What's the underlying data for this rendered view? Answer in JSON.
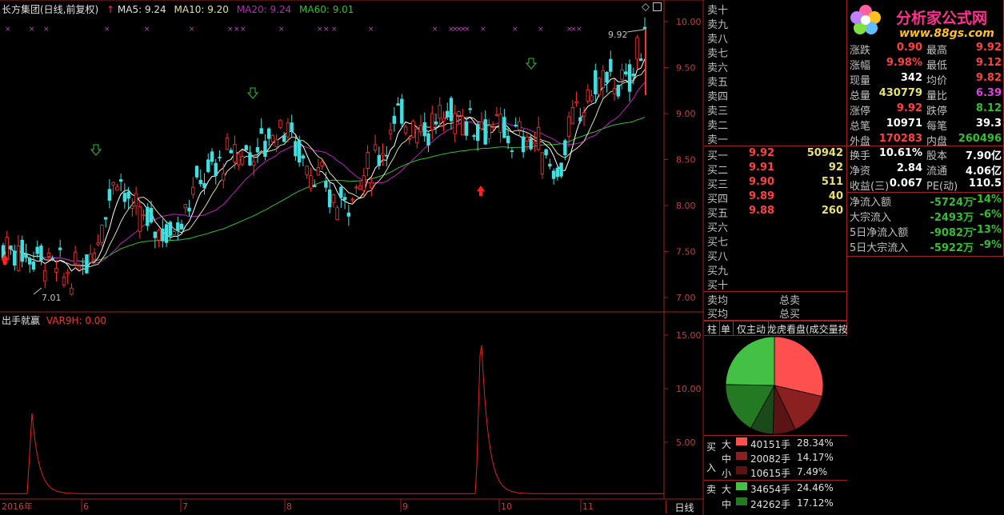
{
  "header": {
    "title": "长方集团(日线,前复权)",
    "ma5": "MA5: 9.24",
    "ma10": "MA10: 9.20",
    "ma20": "MA20: 9.24",
    "ma60": "MA60: 9.01"
  },
  "indicator": {
    "name": "出手就赢",
    "var": "VAR9H: 0.00"
  },
  "price_axis": [
    "10.00",
    "9.50",
    "9.00",
    "8.50",
    "8.00",
    "7.50",
    "7.00"
  ],
  "indicator_axis": [
    "15.00",
    "10.00",
    "5.00"
  ],
  "annotations": {
    "high": "9.92",
    "low": "7.01"
  },
  "date_axis": {
    "year": "2016年",
    "months": [
      "6",
      "7",
      "8",
      "9",
      "10",
      "11"
    ],
    "period": "日线"
  },
  "sell_book": [
    {
      "label": "卖十",
      "price": "",
      "vol": ""
    },
    {
      "label": "卖九",
      "price": "",
      "vol": ""
    },
    {
      "label": "卖八",
      "price": "",
      "vol": ""
    },
    {
      "label": "卖七",
      "price": "",
      "vol": ""
    },
    {
      "label": "卖六",
      "price": "",
      "vol": ""
    },
    {
      "label": "卖五",
      "price": "",
      "vol": ""
    },
    {
      "label": "卖四",
      "price": "",
      "vol": ""
    },
    {
      "label": "卖三",
      "price": "",
      "vol": ""
    },
    {
      "label": "卖二",
      "price": "",
      "vol": ""
    },
    {
      "label": "卖一",
      "price": "",
      "vol": ""
    }
  ],
  "buy_book": [
    {
      "label": "买一",
      "price": "9.92",
      "vol": "50942"
    },
    {
      "label": "买二",
      "price": "9.91",
      "vol": "92"
    },
    {
      "label": "买三",
      "price": "9.90",
      "vol": "511"
    },
    {
      "label": "买四",
      "price": "9.89",
      "vol": "40"
    },
    {
      "label": "买五",
      "price": "9.88",
      "vol": "260"
    },
    {
      "label": "买六",
      "price": "",
      "vol": ""
    },
    {
      "label": "买七",
      "price": "",
      "vol": ""
    },
    {
      "label": "买八",
      "price": "",
      "vol": ""
    },
    {
      "label": "买九",
      "price": "",
      "vol": ""
    },
    {
      "label": "买十",
      "price": "",
      "vol": ""
    }
  ],
  "avg": {
    "sell_avg": "卖均",
    "sell_total": "总卖",
    "buy_avg": "买均",
    "buy_total": "总买"
  },
  "quote": [
    {
      "l1": "涨跌",
      "v1": "0.90",
      "l2": "最高",
      "v2": "9.92",
      "c1": "red",
      "c2": "red"
    },
    {
      "l1": "涨幅",
      "v1": "9.98%",
      "l2": "最低",
      "v2": "9.12",
      "c1": "red",
      "c2": "red"
    },
    {
      "l1": "现量",
      "v1": "342",
      "l2": "均价",
      "v2": "9.82",
      "c1": "wht",
      "c2": "red"
    },
    {
      "l1": "总量",
      "v1": "430779",
      "l2": "量比",
      "v2": "6.39",
      "c1": "yel",
      "c2": "mag"
    },
    {
      "l1": "涨停",
      "v1": "9.92",
      "l2": "跌停",
      "v2": "8.12",
      "c1": "red",
      "c2": "grn"
    },
    {
      "l1": "总笔",
      "v1": "10971",
      "l2": "每笔",
      "v2": "39.3",
      "c1": "wht",
      "c2": "wht"
    },
    {
      "l1": "外盘",
      "v1": "170283",
      "l2": "内盘",
      "v2": "260496",
      "c1": "red",
      "c2": "grn"
    },
    {
      "l1": "换手",
      "v1": "10.61%",
      "l2": "股本",
      "v2": "7.90亿",
      "c1": "wht",
      "c2": "wht"
    },
    {
      "l1": "净资",
      "v1": "2.84",
      "l2": "流通",
      "v2": "4.06亿",
      "c1": "wht",
      "c2": "wht"
    },
    {
      "l1": "收益(三)",
      "v1": "0.067",
      "l2": "PE(动)",
      "v2": "110.5",
      "c1": "wht",
      "c2": "wht"
    }
  ],
  "flows": [
    {
      "label": "净流入额",
      "value": "-5724万",
      "pct": "-14%"
    },
    {
      "label": "大宗流入",
      "value": "-2493万",
      "pct": "-6%"
    },
    {
      "label": "5日净流入额",
      "value": "-9082万",
      "pct": "-13%"
    },
    {
      "label": "5日大宗流入",
      "value": "-5922万",
      "pct": "-9%"
    }
  ],
  "tabs": [
    "柱",
    "单",
    "仅主动",
    "龙虎看盘(成交量按"
  ],
  "pie": {
    "slices": [
      {
        "name": "买大",
        "pct": 28.34,
        "color": "#ff5050"
      },
      {
        "name": "买中",
        "pct": 14.17,
        "color": "#8a2020"
      },
      {
        "name": "买小",
        "pct": 7.49,
        "color": "#5a1414"
      },
      {
        "name": "卖小",
        "pct": 7.49,
        "color": "#1a4a1a"
      },
      {
        "name": "卖中",
        "pct": 17.12,
        "color": "#237a23"
      },
      {
        "name": "卖大",
        "pct": 24.46,
        "color": "#44c044"
      }
    ]
  },
  "legend": {
    "buy_label": "买入",
    "sell_label": "卖",
    "buy": [
      {
        "size": "大",
        "vol": "40151手",
        "pct": "28.34%",
        "color": "#ff5050"
      },
      {
        "size": "中",
        "vol": "20082手",
        "pct": "14.17%",
        "color": "#8a2020"
      },
      {
        "size": "小",
        "vol": "10615手",
        "pct": "7.49%",
        "color": "#5a1414"
      }
    ],
    "sell": [
      {
        "size": "大",
        "vol": "34654手",
        "pct": "24.46%",
        "color": "#44c044"
      },
      {
        "size": "中",
        "vol": "24262手",
        "pct": "17.12%",
        "color": "#237a23"
      }
    ]
  },
  "logo": {
    "text": "分析家公式网",
    "url_text": "www.88gs.com"
  }
}
